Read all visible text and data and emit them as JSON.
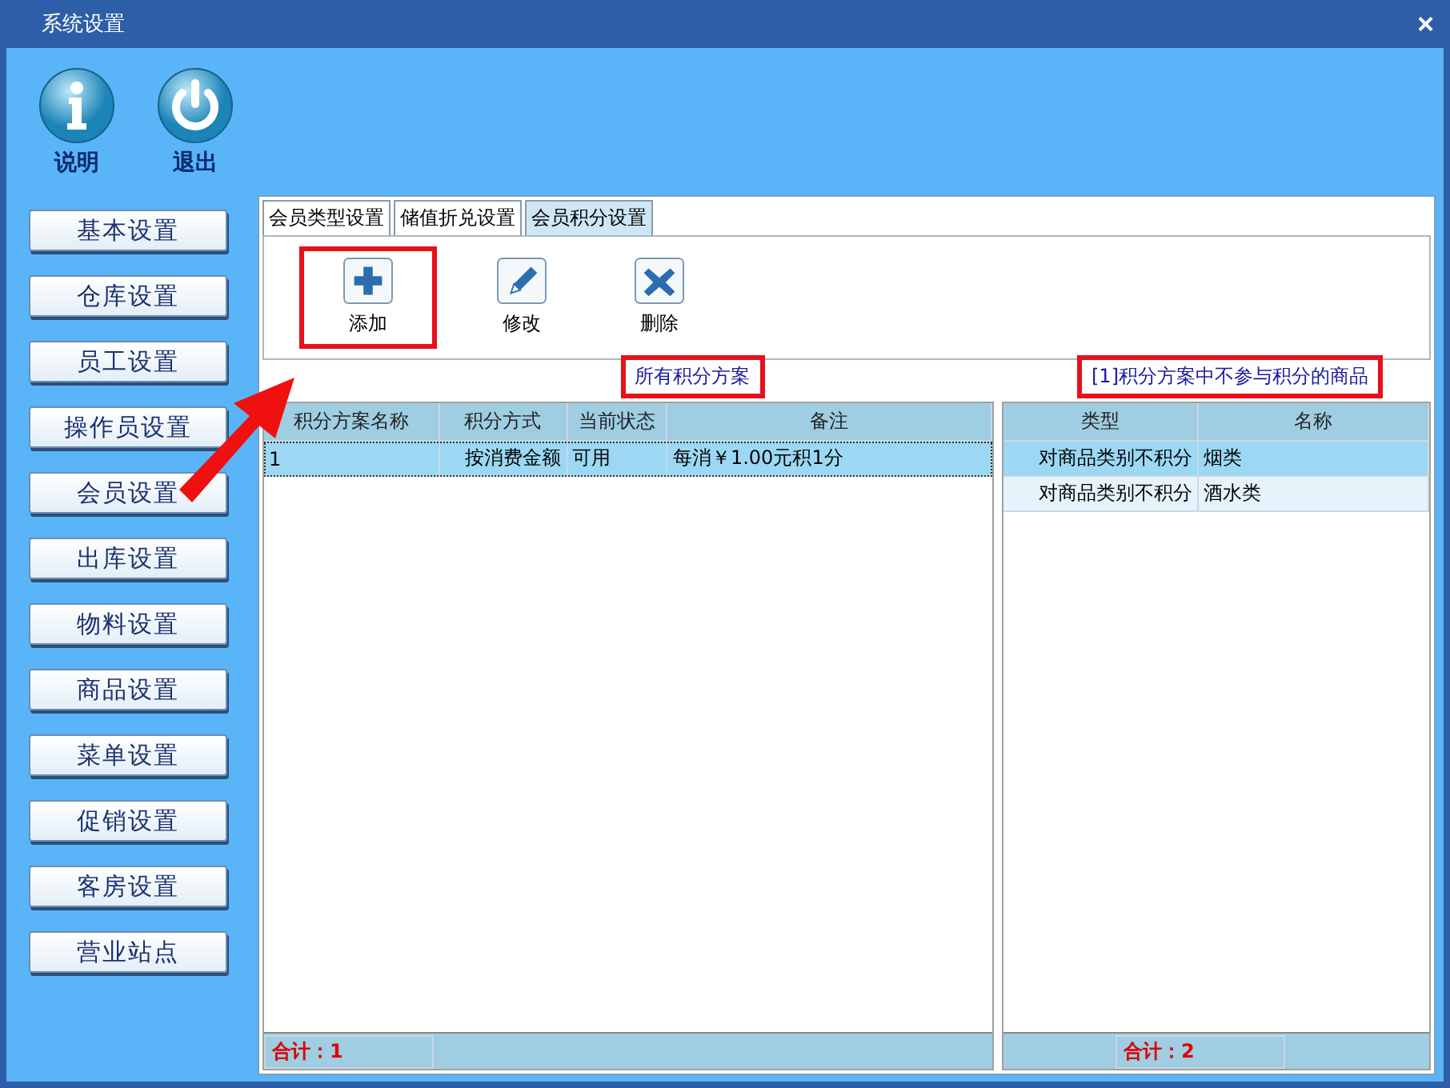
{
  "window": {
    "title": "系统设置",
    "close": "×"
  },
  "toolbar": [
    {
      "label": "说明",
      "kind": "info"
    },
    {
      "label": "退出",
      "kind": "power"
    }
  ],
  "sidebar": {
    "items": [
      "基本设置",
      "仓库设置",
      "员工设置",
      "操作员设置",
      "会员设置",
      "出库设置",
      "物料设置",
      "商品设置",
      "菜单设置",
      "促销设置",
      "客房设置",
      "营业站点"
    ]
  },
  "tabs": [
    {
      "label": "会员类型设置",
      "selected": false
    },
    {
      "label": "储值折兑设置",
      "selected": false
    },
    {
      "label": "会员积分设置",
      "selected": true
    }
  ],
  "actions": [
    {
      "label": "添加",
      "kind": "add",
      "highlighted": true
    },
    {
      "label": "修改",
      "kind": "edit",
      "highlighted": false
    },
    {
      "label": "删除",
      "kind": "delete",
      "highlighted": false
    }
  ],
  "schemes": {
    "title": "所有积分方案",
    "highlighted": true,
    "columns": [
      "积分方案名称",
      "积分方式",
      "当前状态",
      "备注"
    ],
    "rows": [
      {
        "cells": [
          "1",
          "按消费金额",
          "可用",
          "每消￥1.00元积1分"
        ],
        "selected": true
      }
    ],
    "total": "合计：1"
  },
  "excluded": {
    "title": "[1]积分方案中不参与积分的商品",
    "highlighted": true,
    "columns": [
      "类型",
      "名称"
    ],
    "rows": [
      {
        "cells": [
          "对商品类别不积分",
          "烟类"
        ],
        "selected": true
      },
      {
        "cells": [
          "对商品类别不积分",
          "酒水类"
        ],
        "selected": false
      }
    ],
    "total": "合计：2"
  }
}
